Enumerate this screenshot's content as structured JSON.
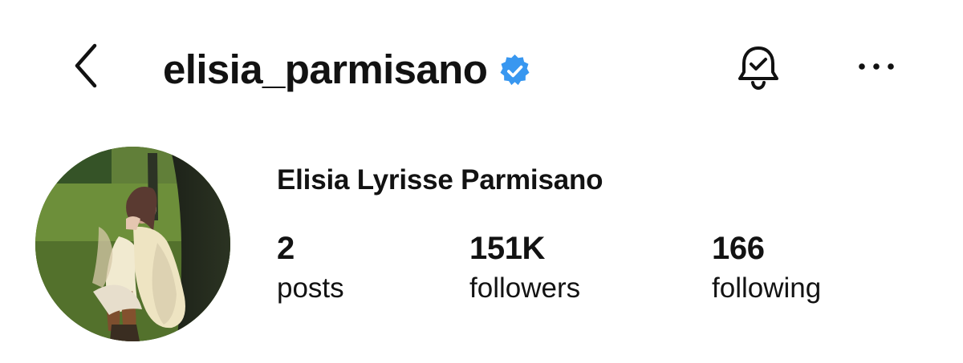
{
  "header": {
    "username": "elisia_parmisano",
    "verified": true,
    "back_icon": "chevron-left-icon",
    "notification_icon": "bell-check-icon",
    "more_icon": "ellipsis-horizontal-icon",
    "verified_color": "#3897f0"
  },
  "profile": {
    "display_name": "Elisia Lyrisse Parmisano",
    "avatar_alt": "profile photo"
  },
  "stats": [
    {
      "value": "2",
      "label": "posts"
    },
    {
      "value": "151K",
      "label": "followers"
    },
    {
      "value": "166",
      "label": "following"
    }
  ]
}
